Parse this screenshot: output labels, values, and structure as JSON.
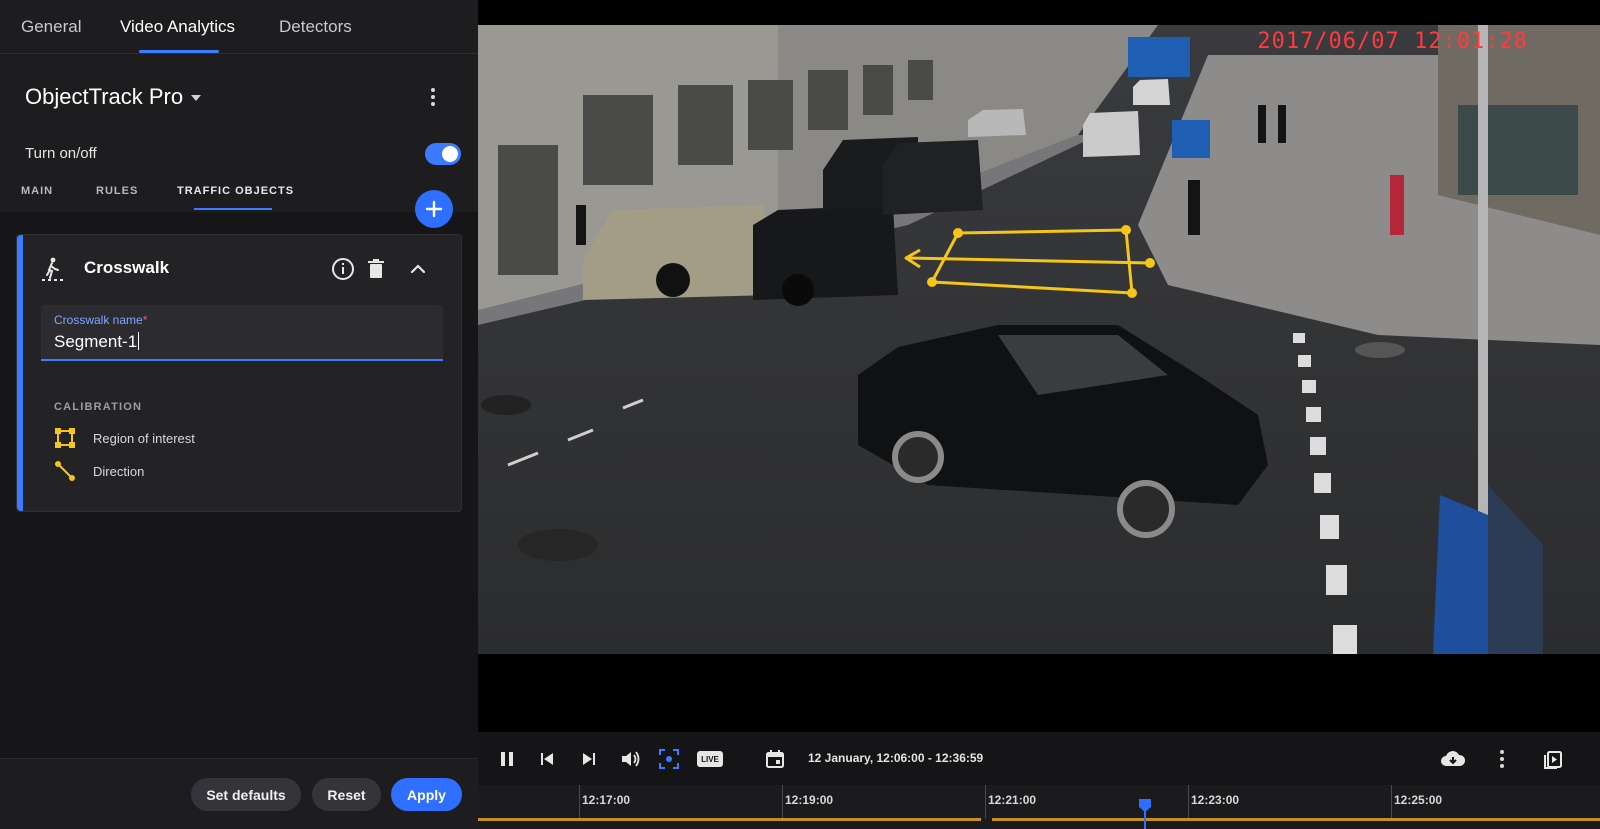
{
  "top_tabs": [
    {
      "label": "General",
      "active": false
    },
    {
      "label": "Video Analytics",
      "active": true
    },
    {
      "label": "Detectors",
      "active": false
    }
  ],
  "plugin": {
    "title": "ObjectTrack Pro"
  },
  "toggle": {
    "label": "Turn on/off",
    "on": true
  },
  "sub_tabs": [
    {
      "label": "MAIN",
      "active": false
    },
    {
      "label": "RULES",
      "active": false
    },
    {
      "label": "TRAFFIC OBJECTS",
      "active": true
    }
  ],
  "card": {
    "title": "Crosswalk",
    "name_label": "Crosswalk name",
    "required_mark": "*",
    "name_value": "Segment-1",
    "calibration_header": "CALIBRATION",
    "calibration_items": [
      {
        "label": "Region of interest",
        "icon": "region-of-interest-icon"
      },
      {
        "label": "Direction",
        "icon": "direction-icon"
      }
    ]
  },
  "footer": {
    "set_defaults": "Set defaults",
    "reset": "Reset",
    "apply": "Apply"
  },
  "video": {
    "osd_timestamp": "2017/06/07 12:01:28"
  },
  "player": {
    "range": "12 January, 12:06:00 - 12:36:59",
    "live_badge": "LIVE"
  },
  "timeline": {
    "ticks": [
      "12:17:00",
      "12:19:00",
      "12:21:00",
      "12:23:00",
      "12:25:00"
    ]
  },
  "colors": {
    "accent": "#3b7bff",
    "overlay": "#f5c518",
    "timeline_track": "#c58f22",
    "osd": "#ff3b3b"
  }
}
